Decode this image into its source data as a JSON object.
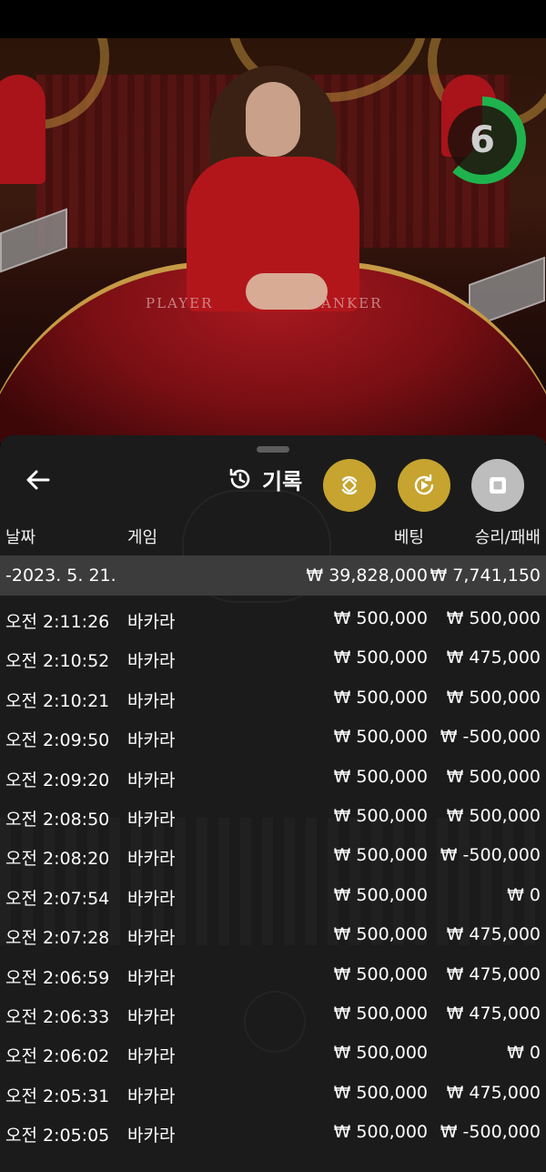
{
  "timer": {
    "value": "6"
  },
  "felt": {
    "player": "PLAYER",
    "banker": "BANKER"
  },
  "history": {
    "title": "기록",
    "columns": {
      "date": "날짜",
      "game": "게임",
      "bet": "베팅",
      "winloss": "승리/패배"
    },
    "date_group": {
      "date": "-2023. 5. 21.",
      "total_bet": "₩ 39,828,000",
      "total_winloss": "₩ 7,741,150"
    },
    "rows": [
      {
        "time": "오전 2:11:26",
        "game": "바카라",
        "bet": "₩ 500,000",
        "winloss": "₩ 500,000"
      },
      {
        "time": "오전 2:10:52",
        "game": "바카라",
        "bet": "₩ 500,000",
        "winloss": "₩ 475,000"
      },
      {
        "time": "오전 2:10:21",
        "game": "바카라",
        "bet": "₩ 500,000",
        "winloss": "₩ 500,000"
      },
      {
        "time": "오전 2:09:50",
        "game": "바카라",
        "bet": "₩ 500,000",
        "winloss": "₩ -500,000"
      },
      {
        "time": "오전 2:09:20",
        "game": "바카라",
        "bet": "₩ 500,000",
        "winloss": "₩ 500,000"
      },
      {
        "time": "오전 2:08:50",
        "game": "바카라",
        "bet": "₩ 500,000",
        "winloss": "₩ 500,000"
      },
      {
        "time": "오전 2:08:20",
        "game": "바카라",
        "bet": "₩ 500,000",
        "winloss": "₩ -500,000"
      },
      {
        "time": "오전 2:07:54",
        "game": "바카라",
        "bet": "₩ 500,000",
        "winloss": "₩ 0"
      },
      {
        "time": "오전 2:07:28",
        "game": "바카라",
        "bet": "₩ 500,000",
        "winloss": "₩ 475,000"
      },
      {
        "time": "오전 2:06:59",
        "game": "바카라",
        "bet": "₩ 500,000",
        "winloss": "₩ 475,000"
      },
      {
        "time": "오전 2:06:33",
        "game": "바카라",
        "bet": "₩ 500,000",
        "winloss": "₩ 475,000"
      },
      {
        "time": "오전 2:06:02",
        "game": "바카라",
        "bet": "₩ 500,000",
        "winloss": "₩ 0"
      },
      {
        "time": "오전 2:05:31",
        "game": "바카라",
        "bet": "₩ 500,000",
        "winloss": "₩ 475,000"
      },
      {
        "time": "오전 2:05:05",
        "game": "바카라",
        "bet": "₩ 500,000",
        "winloss": "₩ -500,000"
      }
    ]
  },
  "icons": {
    "back": "arrow-left-icon",
    "history": "history-clock-icon",
    "autoplay": "repeat-icon",
    "replay": "replay-icon",
    "stop": "stop-icon"
  },
  "colors": {
    "gold": "#c6a42f",
    "timer_green": "#1fb34d",
    "panel_bg": "#1b1b1b",
    "date_row_bg": "#3c3c3c"
  }
}
